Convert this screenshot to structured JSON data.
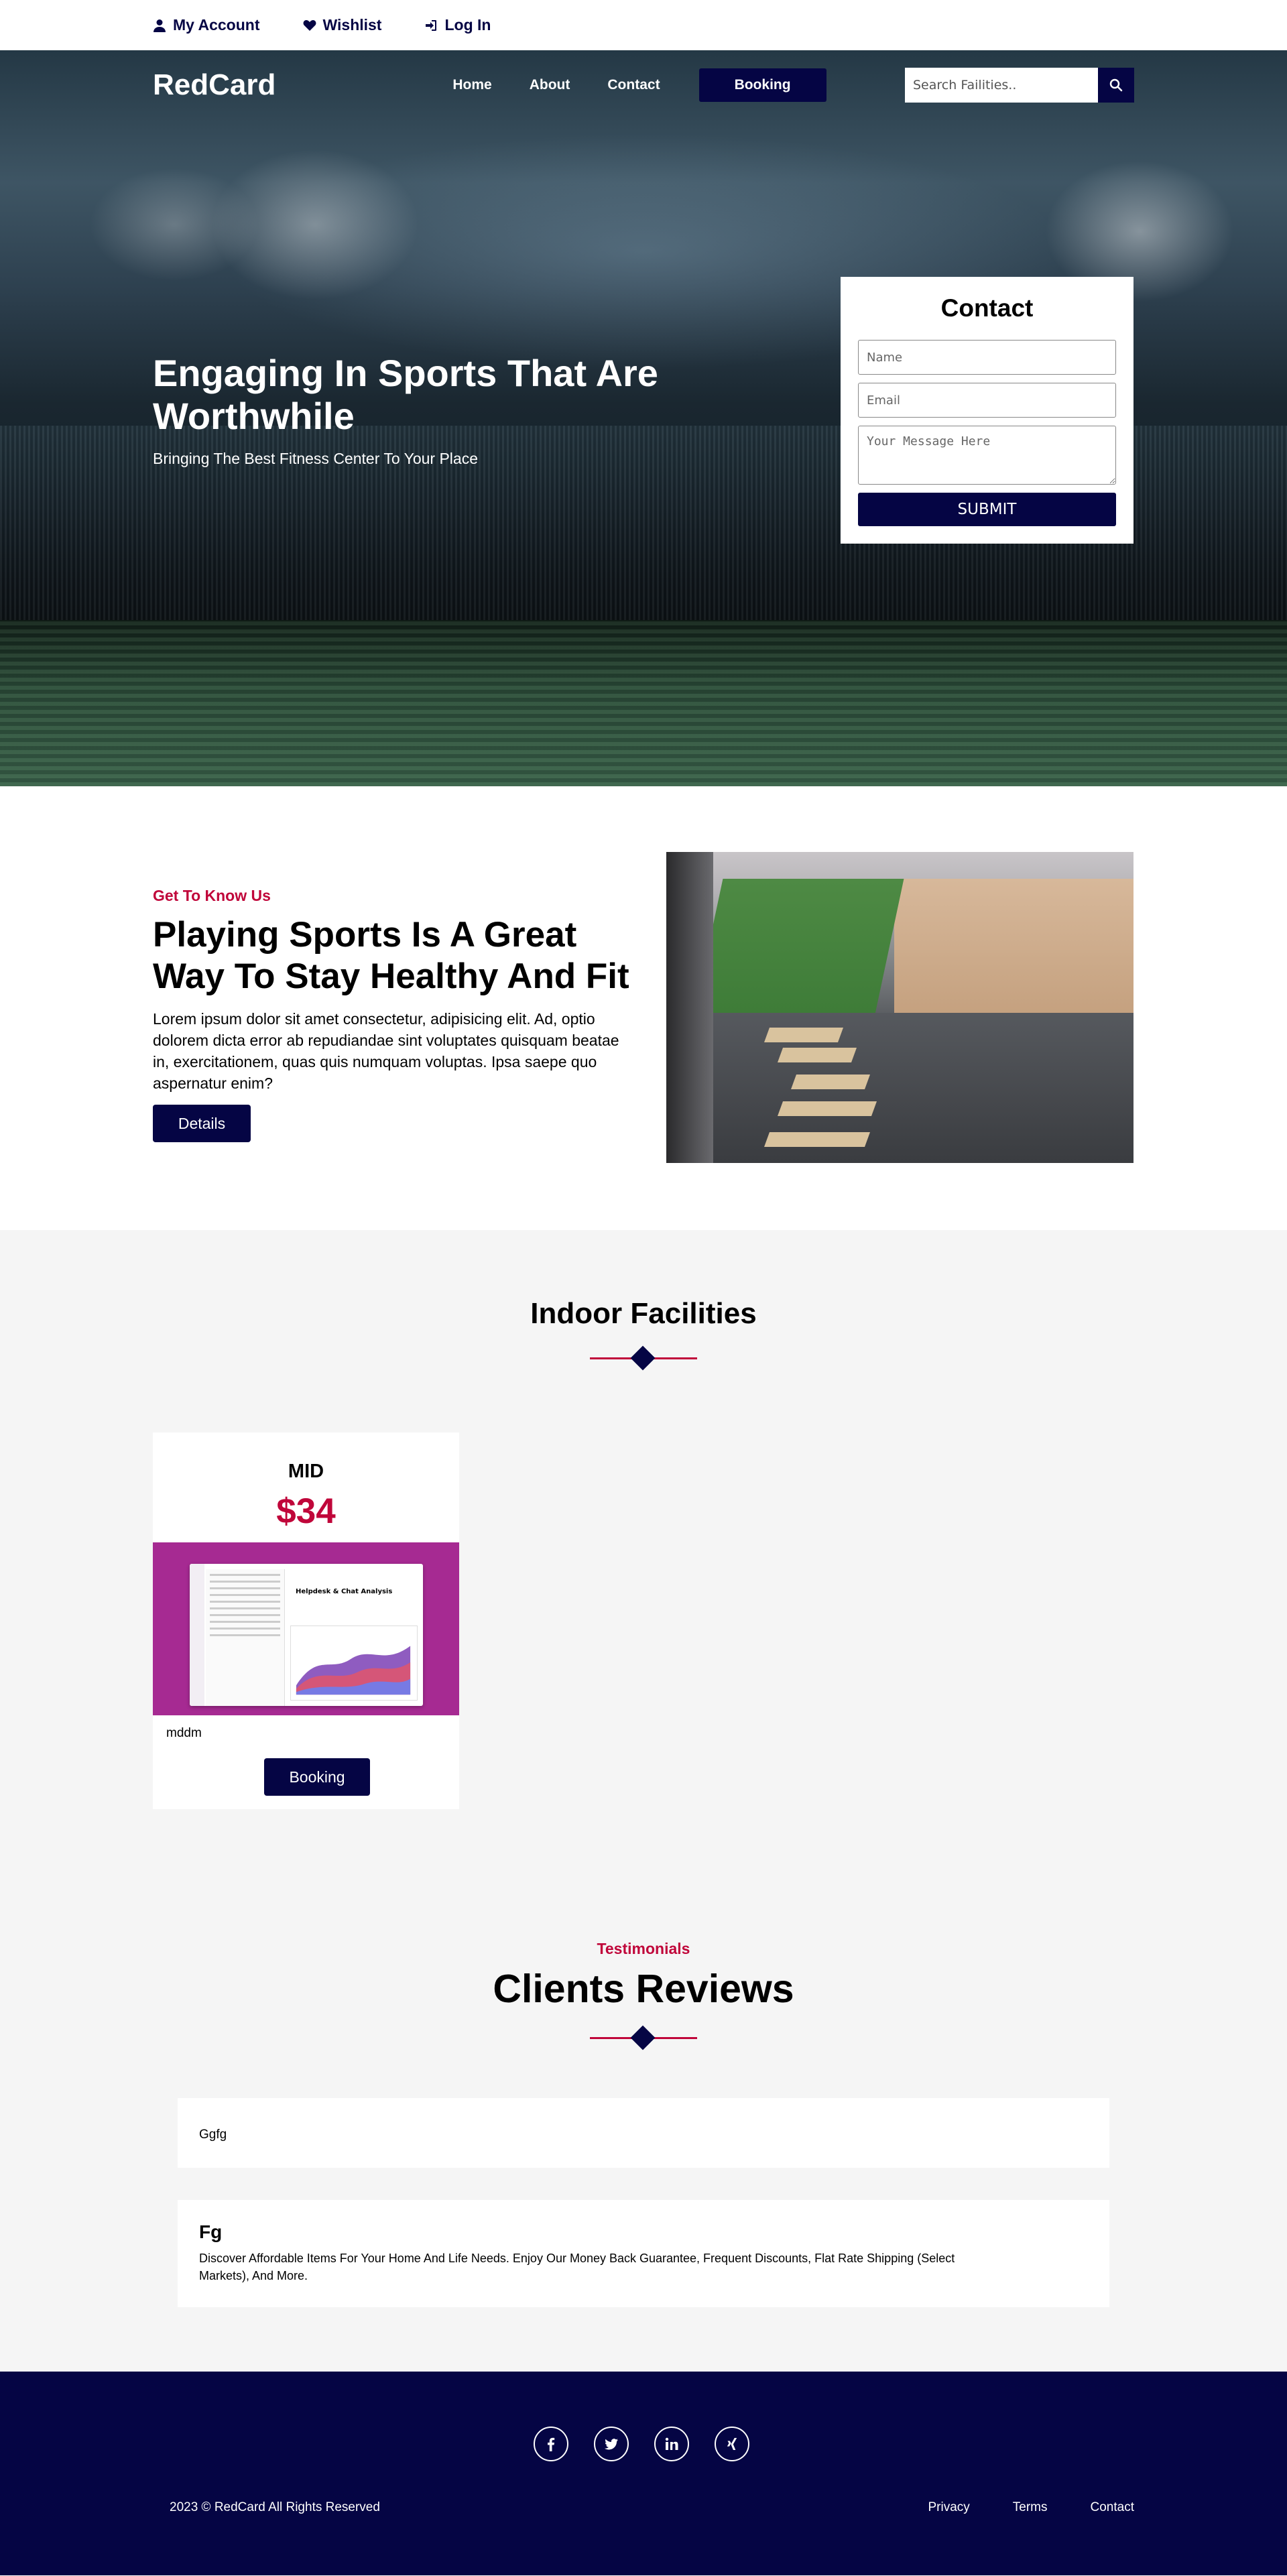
{
  "topbar": {
    "account": "My Account",
    "wishlist": "Wishlist",
    "login": "Log In"
  },
  "nav": {
    "logo": "RedCard",
    "links": [
      "Home",
      "About",
      "Contact"
    ],
    "booking": "Booking",
    "search_placeholder": "Search Failities.."
  },
  "hero": {
    "title": "Engaging In Sports That Are Worthwhile",
    "subtitle": "Bringing The Best Fitness Center To Your Place"
  },
  "contact_form": {
    "title": "Contact",
    "name_placeholder": "Name",
    "email_placeholder": "Email",
    "message_placeholder": "Your Message Here",
    "submit": "SUBMIT"
  },
  "about": {
    "eyebrow": "Get To Know Us",
    "title": "Playing Sports Is A Great Way To Stay Healthy And Fit",
    "body": "Lorem ipsum dolor sit amet consectetur, adipisicing elit. Ad, optio dolorem dicta error ab repudiandae sint voluptates quisquam beatae in, exercitationem, quas quis numquam voluptas. Ipsa saepe quo aspernatur enim?",
    "button": "Details"
  },
  "facilities": {
    "title": "Indoor Facilities",
    "cards": [
      {
        "name": "MID",
        "price": "$34",
        "image_text": "Helpdesk & Chat Analysis",
        "description": "mddm",
        "button": "Booking"
      }
    ]
  },
  "testimonials": {
    "eyebrow": "Testimonials",
    "title": "Clients Reviews",
    "reviews": [
      {
        "text": "Ggfg"
      },
      {
        "title": "Fg",
        "text": "Discover Affordable Items For Your Home And Life Needs. Enjoy Our Money Back Guarantee, Frequent Discounts, Flat Rate Shipping (Select Markets), And More."
      }
    ]
  },
  "footer": {
    "socials": [
      "facebook-icon",
      "twitter-icon",
      "linkedin-icon",
      "xing-icon"
    ],
    "copyright": "2023 © RedCard All Rights Reserved",
    "links": [
      "Privacy",
      "Terms",
      "Contact"
    ]
  },
  "colors": {
    "navy": "#050544",
    "accent_red": "#c0063a",
    "section_gray": "#f5f5f5"
  }
}
